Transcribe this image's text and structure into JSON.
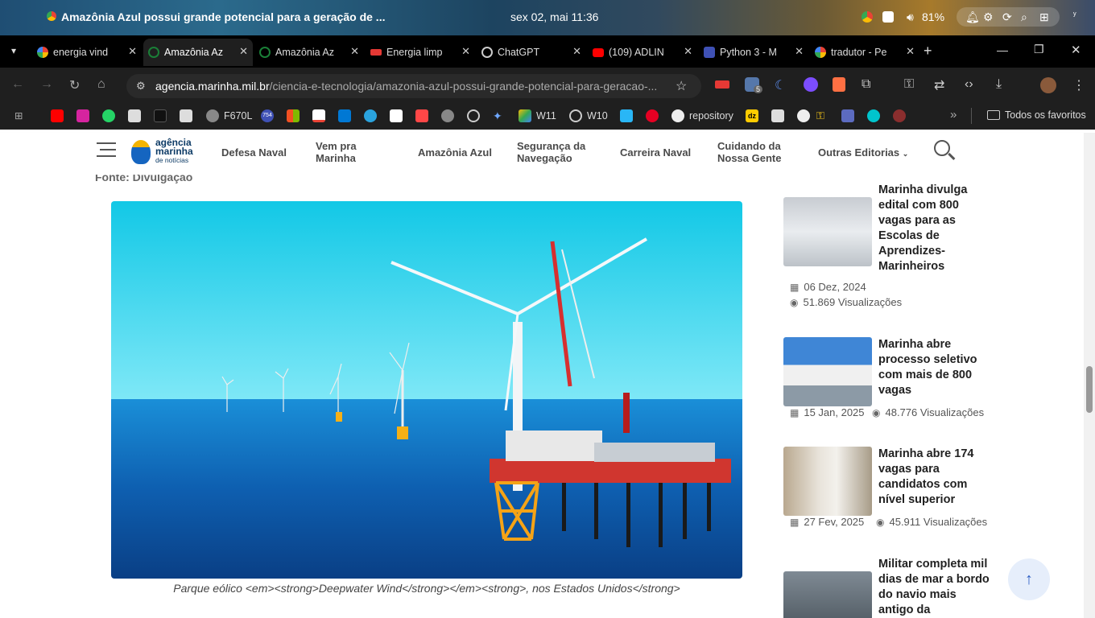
{
  "menubar": {
    "window_title": "Amazônia Azul possui grande potencial para a geração de ...",
    "clock": "sex 02, mai 11:36",
    "battery": "81%"
  },
  "tabs": [
    {
      "label": "energia vind",
      "color": "#4285f4"
    },
    {
      "label": "Amazônia Az",
      "color": "#1a7f37"
    },
    {
      "label": "Amazônia Az",
      "color": "#1a7f37"
    },
    {
      "label": "Energia limp",
      "color": "#e53935"
    },
    {
      "label": "ChatGPT",
      "color": "#cccccc"
    },
    {
      "label": "(109) ADLIN",
      "color": "#ff0000"
    },
    {
      "label": "Python 3 - M",
      "color": "#3f51b5"
    },
    {
      "label": "tradutor - Pe",
      "color": "#4285f4"
    }
  ],
  "address": {
    "host": "agencia.marinha.mil.br",
    "path": "/ciencia-e-tecnologia/amazonia-azul-possui-grande-potencial-para-geracao-..."
  },
  "extensions": {
    "badge": "5"
  },
  "bookmarks": {
    "f670l": "F670L",
    "count754": "754",
    "w11": "W11",
    "w10": "W10",
    "repository": "repository",
    "dz": "dz",
    "more": "»",
    "all": "Todos os favoritos"
  },
  "site": {
    "logo_line1": "agência",
    "logo_line2": "marinha",
    "logo_line3": "de notícias",
    "nav": [
      "Defesa Naval",
      "Vem pra Marinha",
      "Amazônia Azul",
      "Segurança da Navegação",
      "Carreira Naval",
      "Cuidando da Nossa Gente",
      "Outras Editorias"
    ]
  },
  "article": {
    "source_label": "Fonte: Divulgação",
    "caption": "Parque eólico <em><strong>Deepwater Wind</strong></em><strong>, nos Estados Unidos</strong>"
  },
  "sidebar": [
    {
      "title": "Marinha divulga edital com 800 vagas para as Escolas de Aprendizes-Marinheiros",
      "date": "06 Dez, 2024",
      "views": "51.869 Visualizações"
    },
    {
      "title": "Marinha abre processo seletivo com mais de 800 vagas",
      "date": "15 Jan, 2025",
      "views": "48.776 Visualizações"
    },
    {
      "title": "Marinha abre 174 vagas para candidatos com nível superior",
      "date": "27 Fev, 2025",
      "views": "45.911 Visualizações"
    },
    {
      "title": "Militar completa mil dias de mar a bordo do navio mais antigo da",
      "date": "",
      "views": ""
    }
  ]
}
